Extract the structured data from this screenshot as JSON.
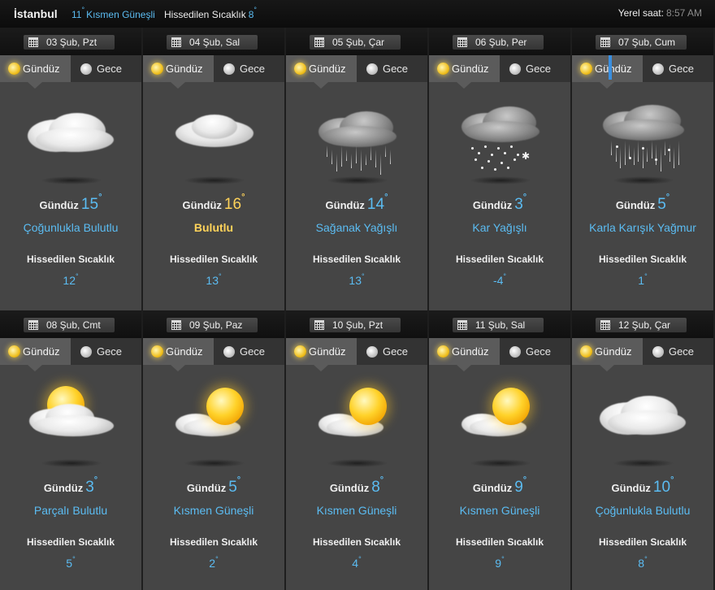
{
  "header": {
    "city": "İstanbul",
    "current_temp": "11",
    "current_condition": "Kısmen Güneşli",
    "feels_label": "Hissedilen Sıcaklık",
    "feels_value": "8",
    "local_time_label": "Yerel saat:",
    "local_time": "8:57 AM"
  },
  "labels": {
    "day_tab": "Gündüz",
    "night_tab": "Gece",
    "day_prefix": "Gündüz",
    "feels": "Hissedilen Sıcaklık",
    "degree": "°"
  },
  "days": [
    {
      "date": "03 Şub, Pzt",
      "temp": "15",
      "condition": "Çoğunlukla Bulutlu",
      "feels": "12",
      "icon": "mostly-cloudy-icon",
      "warm": false
    },
    {
      "date": "04 Şub, Sal",
      "temp": "16",
      "condition": "Bulutlu",
      "feels": "13",
      "icon": "cloudy-icon",
      "warm": true
    },
    {
      "date": "05 Şub, Çar",
      "temp": "14",
      "condition": "Sağanak Yağışlı",
      "feels": "13",
      "icon": "showers-icon",
      "warm": false
    },
    {
      "date": "06 Şub, Per",
      "temp": "3",
      "condition": "Kar Yağışlı",
      "feels": "-4",
      "icon": "snow-icon",
      "warm": false
    },
    {
      "date": "07 Şub, Cum",
      "temp": "5",
      "condition": "Karla Karışık Yağmur",
      "feels": "1",
      "icon": "sleet-icon",
      "warm": false
    },
    {
      "date": "08 Şub, Cmt",
      "temp": "3",
      "condition": "Parçalı Bulutlu",
      "feels": "5",
      "icon": "partly-cloudy-icon",
      "warm": false
    },
    {
      "date": "09 Şub, Paz",
      "temp": "5",
      "condition": "Kısmen Güneşli",
      "feels": "2",
      "icon": "partly-sunny-icon",
      "warm": false
    },
    {
      "date": "10 Şub, Pzt",
      "temp": "8",
      "condition": "Kısmen Güneşli",
      "feels": "4",
      "icon": "partly-sunny-icon",
      "warm": false
    },
    {
      "date": "11 Şub, Sal",
      "temp": "9",
      "condition": "Kısmen Güneşli",
      "feels": "9",
      "icon": "partly-sunny-icon",
      "warm": false
    },
    {
      "date": "12 Şub, Çar",
      "temp": "10",
      "condition": "Çoğunlukla Bulutlu",
      "feels": "8",
      "icon": "mostly-cloudy-icon",
      "warm": false
    }
  ],
  "colors": {
    "accent": "#5bbcf2",
    "warm": "#ffd35a",
    "card": "#454545"
  }
}
